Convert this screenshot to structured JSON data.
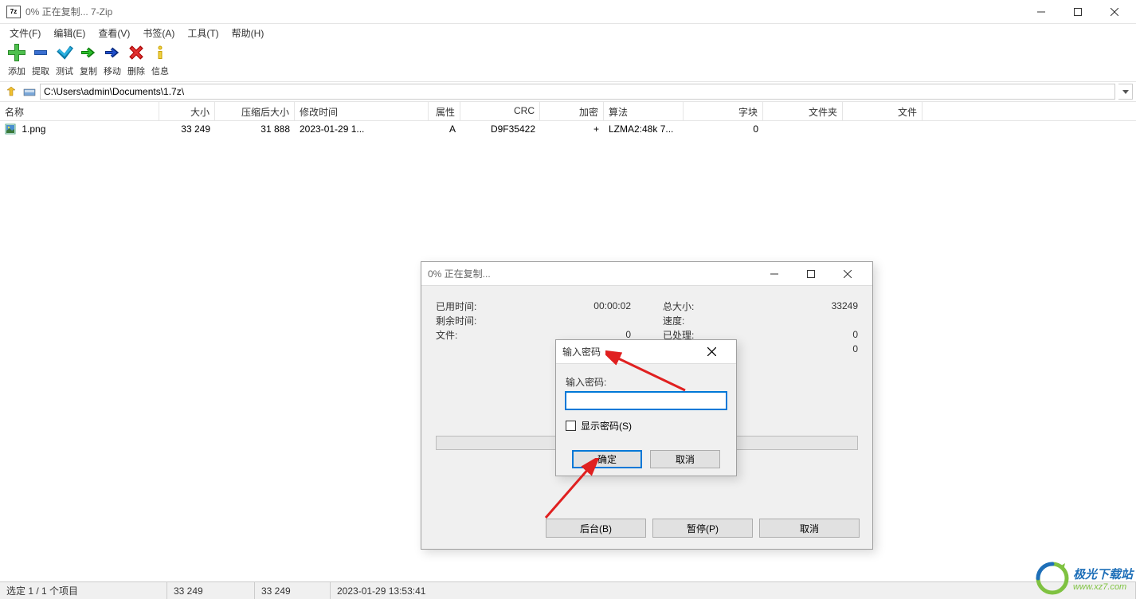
{
  "window": {
    "title": "0% 正在复制... 7-Zip",
    "app_icon_text": "7z"
  },
  "menu": {
    "file": "文件(F)",
    "edit": "编辑(E)",
    "view": "查看(V)",
    "bookmarks": "书签(A)",
    "tools": "工具(T)",
    "help": "帮助(H)"
  },
  "toolbar": {
    "add": "添加",
    "extract": "提取",
    "test": "测试",
    "copy": "复制",
    "move": "移动",
    "delete": "删除",
    "info": "信息"
  },
  "path": "C:\\Users\\admin\\Documents\\1.7z\\",
  "columns": {
    "name": "名称",
    "size": "大小",
    "packed": "压缩后大小",
    "modified": "修改时间",
    "attr": "属性",
    "crc": "CRC",
    "enc": "加密",
    "algo": "算法",
    "block": "字块",
    "folders": "文件夹",
    "files": "文件"
  },
  "rows": [
    {
      "name": "1.png",
      "size": "33 249",
      "packed": "31 888",
      "modified": "2023-01-29 1...",
      "attr": "A",
      "crc": "D9F35422",
      "enc": "+",
      "algo": "LZMA2:48k 7...",
      "block": "0",
      "folders": "",
      "files": ""
    }
  ],
  "status": {
    "selection": "选定 1 / 1 个项目",
    "size1": "33 249",
    "size2": "33 249",
    "date": "2023-01-29 13:53:41"
  },
  "progress_dialog": {
    "title": "0% 正在复制...",
    "elapsed_label": "已用时间:",
    "elapsed_value": "00:00:02",
    "remaining_label": "剩余时间:",
    "files_label": "文件:",
    "files_value": "0",
    "total_label": "总大小:",
    "total_value": "33249",
    "speed_label": "速度:",
    "processed_label": "已处理:",
    "processed_value": "0",
    "extra_value": "0",
    "btn_background": "后台(B)",
    "btn_pause": "暂停(P)",
    "btn_cancel": "取消"
  },
  "password_dialog": {
    "title": "输入密码",
    "label": "输入密码:",
    "show_pwd": "显示密码(S)",
    "ok": "确定",
    "cancel": "取消"
  },
  "watermark": {
    "cn": "极光下载站",
    "en": "www.xz7.com"
  }
}
